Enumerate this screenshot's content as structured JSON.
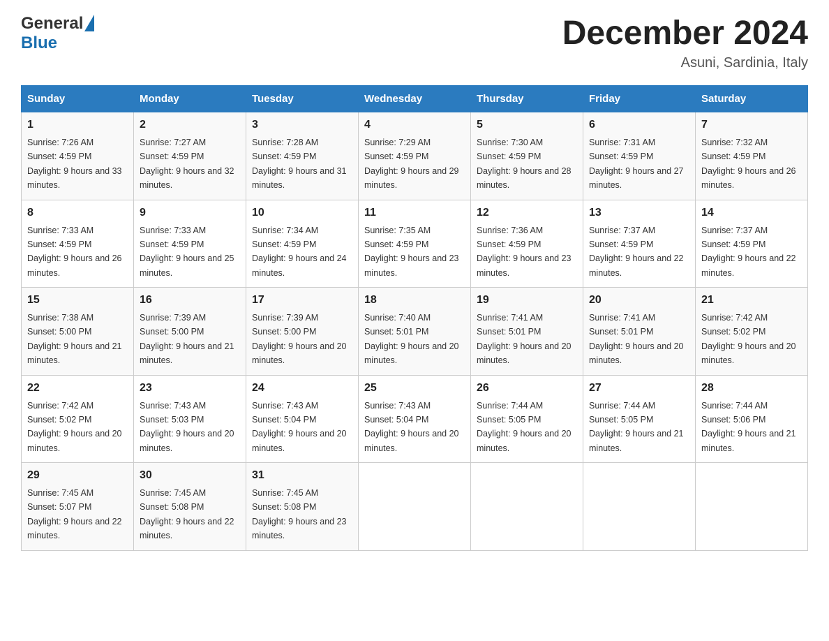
{
  "header": {
    "title": "December 2024",
    "subtitle": "Asuni, Sardinia, Italy",
    "logo_general": "General",
    "logo_blue": "Blue"
  },
  "columns": [
    "Sunday",
    "Monday",
    "Tuesday",
    "Wednesday",
    "Thursday",
    "Friday",
    "Saturday"
  ],
  "weeks": [
    [
      {
        "day": "1",
        "sunrise": "7:26 AM",
        "sunset": "4:59 PM",
        "daylight": "9 hours and 33 minutes."
      },
      {
        "day": "2",
        "sunrise": "7:27 AM",
        "sunset": "4:59 PM",
        "daylight": "9 hours and 32 minutes."
      },
      {
        "day": "3",
        "sunrise": "7:28 AM",
        "sunset": "4:59 PM",
        "daylight": "9 hours and 31 minutes."
      },
      {
        "day": "4",
        "sunrise": "7:29 AM",
        "sunset": "4:59 PM",
        "daylight": "9 hours and 29 minutes."
      },
      {
        "day": "5",
        "sunrise": "7:30 AM",
        "sunset": "4:59 PM",
        "daylight": "9 hours and 28 minutes."
      },
      {
        "day": "6",
        "sunrise": "7:31 AM",
        "sunset": "4:59 PM",
        "daylight": "9 hours and 27 minutes."
      },
      {
        "day": "7",
        "sunrise": "7:32 AM",
        "sunset": "4:59 PM",
        "daylight": "9 hours and 26 minutes."
      }
    ],
    [
      {
        "day": "8",
        "sunrise": "7:33 AM",
        "sunset": "4:59 PM",
        "daylight": "9 hours and 26 minutes."
      },
      {
        "day": "9",
        "sunrise": "7:33 AM",
        "sunset": "4:59 PM",
        "daylight": "9 hours and 25 minutes."
      },
      {
        "day": "10",
        "sunrise": "7:34 AM",
        "sunset": "4:59 PM",
        "daylight": "9 hours and 24 minutes."
      },
      {
        "day": "11",
        "sunrise": "7:35 AM",
        "sunset": "4:59 PM",
        "daylight": "9 hours and 23 minutes."
      },
      {
        "day": "12",
        "sunrise": "7:36 AM",
        "sunset": "4:59 PM",
        "daylight": "9 hours and 23 minutes."
      },
      {
        "day": "13",
        "sunrise": "7:37 AM",
        "sunset": "4:59 PM",
        "daylight": "9 hours and 22 minutes."
      },
      {
        "day": "14",
        "sunrise": "7:37 AM",
        "sunset": "4:59 PM",
        "daylight": "9 hours and 22 minutes."
      }
    ],
    [
      {
        "day": "15",
        "sunrise": "7:38 AM",
        "sunset": "5:00 PM",
        "daylight": "9 hours and 21 minutes."
      },
      {
        "day": "16",
        "sunrise": "7:39 AM",
        "sunset": "5:00 PM",
        "daylight": "9 hours and 21 minutes."
      },
      {
        "day": "17",
        "sunrise": "7:39 AM",
        "sunset": "5:00 PM",
        "daylight": "9 hours and 20 minutes."
      },
      {
        "day": "18",
        "sunrise": "7:40 AM",
        "sunset": "5:01 PM",
        "daylight": "9 hours and 20 minutes."
      },
      {
        "day": "19",
        "sunrise": "7:41 AM",
        "sunset": "5:01 PM",
        "daylight": "9 hours and 20 minutes."
      },
      {
        "day": "20",
        "sunrise": "7:41 AM",
        "sunset": "5:01 PM",
        "daylight": "9 hours and 20 minutes."
      },
      {
        "day": "21",
        "sunrise": "7:42 AM",
        "sunset": "5:02 PM",
        "daylight": "9 hours and 20 minutes."
      }
    ],
    [
      {
        "day": "22",
        "sunrise": "7:42 AM",
        "sunset": "5:02 PM",
        "daylight": "9 hours and 20 minutes."
      },
      {
        "day": "23",
        "sunrise": "7:43 AM",
        "sunset": "5:03 PM",
        "daylight": "9 hours and 20 minutes."
      },
      {
        "day": "24",
        "sunrise": "7:43 AM",
        "sunset": "5:04 PM",
        "daylight": "9 hours and 20 minutes."
      },
      {
        "day": "25",
        "sunrise": "7:43 AM",
        "sunset": "5:04 PM",
        "daylight": "9 hours and 20 minutes."
      },
      {
        "day": "26",
        "sunrise": "7:44 AM",
        "sunset": "5:05 PM",
        "daylight": "9 hours and 20 minutes."
      },
      {
        "day": "27",
        "sunrise": "7:44 AM",
        "sunset": "5:05 PM",
        "daylight": "9 hours and 21 minutes."
      },
      {
        "day": "28",
        "sunrise": "7:44 AM",
        "sunset": "5:06 PM",
        "daylight": "9 hours and 21 minutes."
      }
    ],
    [
      {
        "day": "29",
        "sunrise": "7:45 AM",
        "sunset": "5:07 PM",
        "daylight": "9 hours and 22 minutes."
      },
      {
        "day": "30",
        "sunrise": "7:45 AM",
        "sunset": "5:08 PM",
        "daylight": "9 hours and 22 minutes."
      },
      {
        "day": "31",
        "sunrise": "7:45 AM",
        "sunset": "5:08 PM",
        "daylight": "9 hours and 23 minutes."
      },
      null,
      null,
      null,
      null
    ]
  ]
}
